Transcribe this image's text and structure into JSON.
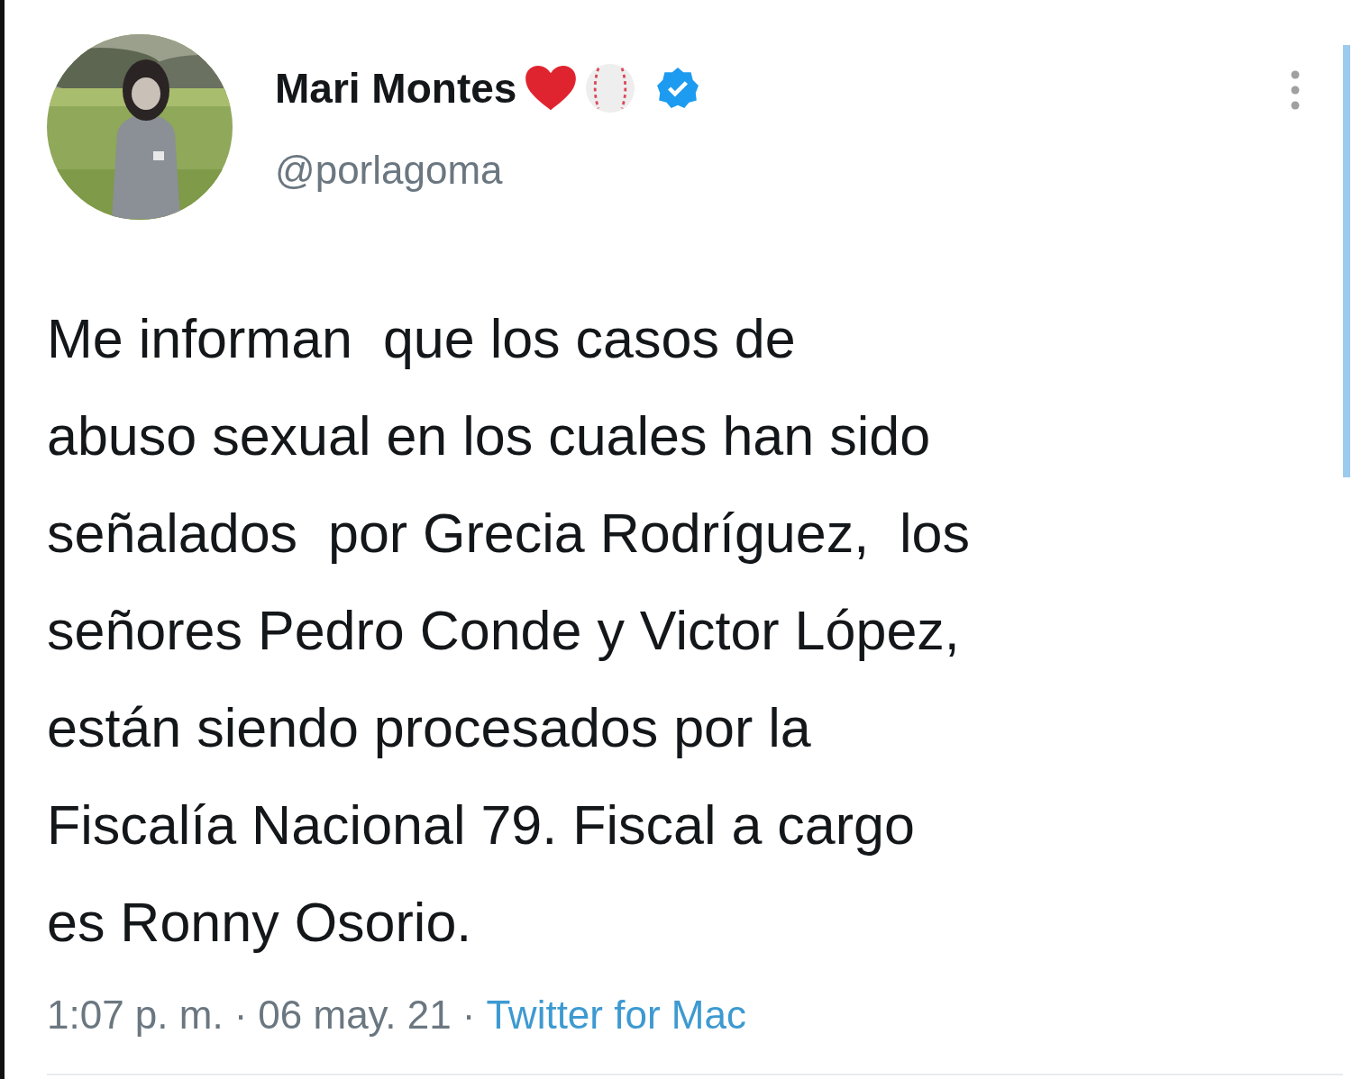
{
  "author": {
    "name": "Mari Montes",
    "verified": true,
    "handle": "@porlagoma"
  },
  "tweet": {
    "text": "Me informan  que los casos de\nabuso sexual en los cuales han sido\nseñalados  por Grecia Rodríguez,  los\nseñores Pedro Conde y Victor López,\nestán siendo procesados por la\nFiscalía Nacional 79. Fiscal a cargo\nes Ronny Osorio."
  },
  "footer": {
    "time": "1:07 p. m.",
    "separator_1": "·",
    "date": "06 may. 21",
    "separator_2": "·",
    "source": "Twitter for Mac"
  }
}
